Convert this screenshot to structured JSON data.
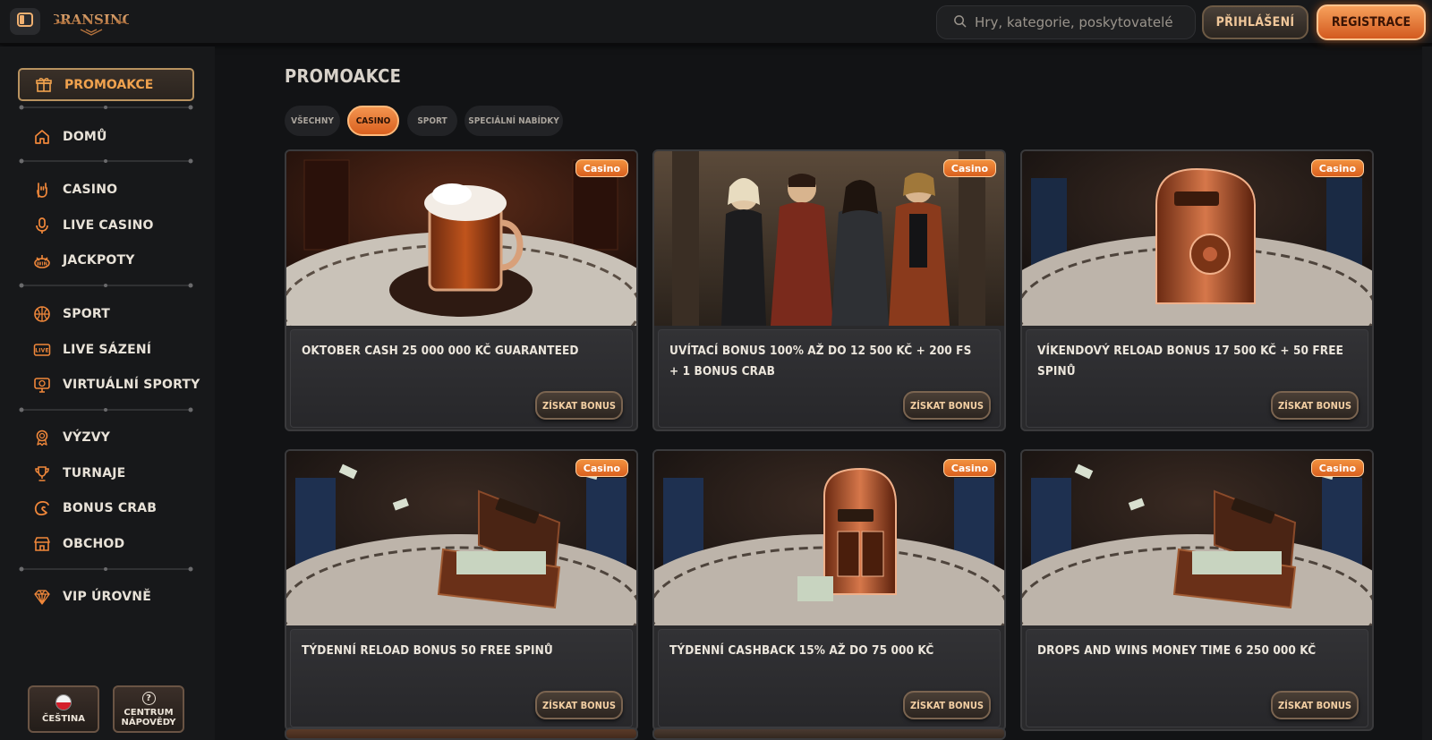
{
  "header": {
    "logo_text": "GRANSINO",
    "search_placeholder": "Hry, kategorie, poskytovatelé",
    "login_label": "PŘIHLÁŠENÍ",
    "register_label": "REGISTRACE"
  },
  "sidebar": {
    "active_item": {
      "label": "PROMOAKCE",
      "icon": "gift-icon"
    },
    "items": [
      {
        "label": "DOMŮ",
        "icon": "home-icon"
      },
      {
        "label": "CASINO",
        "icon": "rock-hand-icon"
      },
      {
        "label": "LIVE CASINO",
        "icon": "microphone-icon"
      },
      {
        "label": "JACKPOTY",
        "icon": "jackpot-icon"
      },
      {
        "label": "SPORT",
        "icon": "basketball-icon"
      },
      {
        "label": "LIVE SÁZENÍ",
        "icon": "live-icon"
      },
      {
        "label": "VIRTUÁLNÍ SPORTY",
        "icon": "monitor-icon"
      },
      {
        "label": "VÝZVY",
        "icon": "medal-icon"
      },
      {
        "label": "TURNAJE",
        "icon": "trophy-icon"
      },
      {
        "label": "BONUS CRAB",
        "icon": "crab-icon"
      },
      {
        "label": "OBCHOD",
        "icon": "shop-icon"
      },
      {
        "label": "VIP ÚROVNĚ",
        "icon": "diamond-icon"
      }
    ],
    "language_label": "ČEŠTINA",
    "help_label_line1": "CENTRUM",
    "help_label_line2": "NÁPOVĚDY"
  },
  "main": {
    "title": "PROMOAKCE",
    "filters": [
      {
        "label": "VŠECHNY",
        "active": false
      },
      {
        "label": "CASINO",
        "active": true
      },
      {
        "label": "SPORT",
        "active": false
      },
      {
        "label": "SPECIÁLNÍ NABÍDKY",
        "active": false
      }
    ],
    "cards": [
      {
        "badge": "Casino",
        "title": "OKTOBER CASH 25 000 000 KČ GUARANTEED",
        "cta": "ZÍSKAT BONUS"
      },
      {
        "badge": "Casino",
        "title": "UVÍTACÍ BONUS 100% AŽ DO 12 500 KČ + 200 FS + 1 BONUS CRAB",
        "cta": "ZÍSKAT BONUS"
      },
      {
        "badge": "Casino",
        "title": "VÍKENDOVÝ RELOAD BONUS 17 500 KČ + 50 FREE SPINŮ",
        "cta": "ZÍSKAT BONUS"
      },
      {
        "badge": "Casino",
        "title": "TÝDENNÍ RELOAD BONUS 50 FREE SPINŮ",
        "cta": "ZÍSKAT BONUS"
      },
      {
        "badge": "Casino",
        "title": "TÝDENNÍ CASHBACK 15% AŽ DO 75 000 KČ",
        "cta": "ZÍSKAT BONUS"
      },
      {
        "badge": "Casino",
        "title": "DROPS AND WINS MONEY TIME 6 250 000 KČ",
        "cta": "ZÍSKAT BONUS"
      }
    ]
  },
  "colors": {
    "accent_orange": "#f0873a",
    "gold": "#b8925f",
    "background": "#121315"
  }
}
